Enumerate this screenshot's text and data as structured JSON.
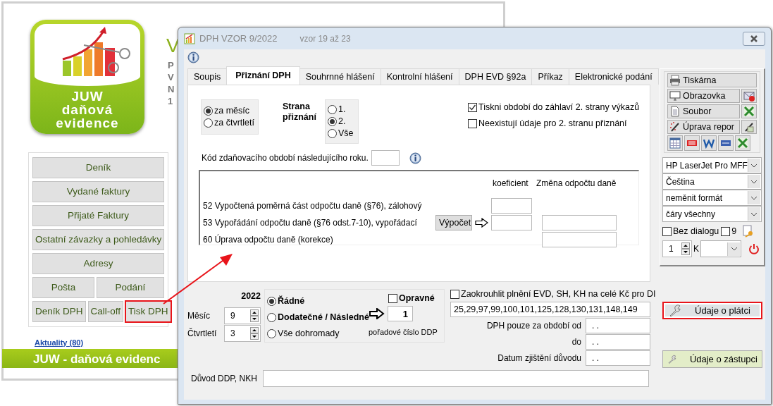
{
  "background_window": {
    "heading": "V",
    "info_lines": [
      "P",
      "V",
      "N",
      "1"
    ],
    "logo": {
      "lines": [
        "JUW",
        "daňová",
        "evidence"
      ]
    },
    "menu_rows": [
      [
        {
          "label": "Deník",
          "highlighted": false
        }
      ],
      [
        {
          "label": "Vydané faktury",
          "highlighted": false
        }
      ],
      [
        {
          "label": "Přijaté Faktury",
          "highlighted": false
        }
      ],
      [
        {
          "label": "Ostatní závazky a pohledávky",
          "highlighted": false
        }
      ],
      [
        {
          "label": "Adresy",
          "highlighted": false
        }
      ],
      [
        {
          "label": "Pošta",
          "highlighted": false
        },
        {
          "label": "Podání",
          "highlighted": false
        }
      ],
      [
        {
          "label": "Deník DPH",
          "highlighted": false
        },
        {
          "label": "Call-off",
          "highlighted": false
        },
        {
          "label": "Tisk DPH",
          "highlighted": true
        }
      ]
    ],
    "news_link": "Aktuality (80)",
    "footer": "JUW - daňová evidenc"
  },
  "dialog": {
    "title": "DPH VZOR  9/2022",
    "subtitle": "vzor  19 až 23",
    "tabs": [
      {
        "label": "Soupis",
        "selected": false
      },
      {
        "label": "Přiznání DPH",
        "selected": true
      },
      {
        "label": "Souhrnné hlášení",
        "selected": false
      },
      {
        "label": "Kontrolní hlášení",
        "selected": false
      },
      {
        "label": "DPH EVD §92a",
        "selected": false
      },
      {
        "label": "Příkaz",
        "selected": false
      },
      {
        "label": "Elektronické podání",
        "selected": false
      }
    ],
    "period_options": [
      {
        "label": "za měsíc",
        "selected": true
      },
      {
        "label": "za čtvrtletí",
        "selected": false
      }
    ],
    "side_label": "Strana přiznání",
    "side_options": [
      {
        "label": "1.",
        "selected": false
      },
      {
        "label": "2.",
        "selected": true
      },
      {
        "label": "Vše",
        "selected": false
      }
    ],
    "checkboxes": [
      {
        "label": "Tiskni období do záhlaví 2. strany výkazů",
        "checked": true
      },
      {
        "label": "Neexistují údaje pro 2. stranu přiznání",
        "checked": false
      }
    ],
    "next_year_code_label": "Kód zdaňovacího období následujícího roku.",
    "deduction": {
      "headers": [
        "koeficient",
        "Změna odpočtu daně"
      ],
      "rows": [
        {
          "label": "52 Vypočtená poměrná část odpočtu daně (§76), zálohový",
          "coefficient_field": true,
          "change_field": false
        },
        {
          "label": "53 Vypořádání odpočtu daně (§76 odst.7-10), vypořádací",
          "button": "Výpočet",
          "coefficient_field": true,
          "change_field": true
        },
        {
          "label": "60 Úprava odpočtu daně (korekce)",
          "coefficient_field": false,
          "change_field": true
        }
      ]
    },
    "year": "2022",
    "month_label": "Měsíc",
    "month": "9",
    "quarter_label": "Čtvrtletí",
    "quarter": "3",
    "filing_types": [
      {
        "label": "Řádné",
        "selected": true
      },
      {
        "label": "Dodatečné / Následné",
        "selected": false
      },
      {
        "label": "Vše dohromady",
        "selected": false
      }
    ],
    "corrective": {
      "label": "Opravné",
      "checked": false
    },
    "sequence": {
      "value": "1",
      "caption": "pořadové číslo DDP"
    },
    "rounding": {
      "label": "Zaokrouhlit plnění EVD, SH, KH na celé Kč pro DI",
      "checked": false,
      "value": "25,29,97,99,100,101,125,128,130,131,148,149"
    },
    "date_fields": [
      {
        "label": "DPH pouze za období od",
        "value": ". ."
      },
      {
        "label": "do",
        "value": ". ."
      },
      {
        "label": "Datum zjištění důvodu",
        "value": ". ."
      }
    ],
    "reason_label": "Důvod DDP, NKH",
    "output_buttons": [
      {
        "label": "Tiskárna",
        "kind": "printer"
      },
      {
        "label": "Obrazovka",
        "kind": "screen"
      },
      {
        "label": "Soubor",
        "kind": "file"
      },
      {
        "label": "Úprava repor",
        "kind": "edit"
      }
    ],
    "dropdowns": [
      "HP LaserJet Pro MFF",
      "Čeština",
      "neměnit formát",
      "čáry všechny"
    ],
    "no_dialog": {
      "label": "Bez dialogu",
      "checked": false
    },
    "nine": {
      "label": "9",
      "checked": false
    },
    "copies": "1",
    "copies_label": "K",
    "action_buttons": [
      {
        "label": "Údaje o plátci",
        "highlighted": true
      },
      {
        "label": "Údaje o zástupci",
        "highlighted": false
      }
    ]
  }
}
